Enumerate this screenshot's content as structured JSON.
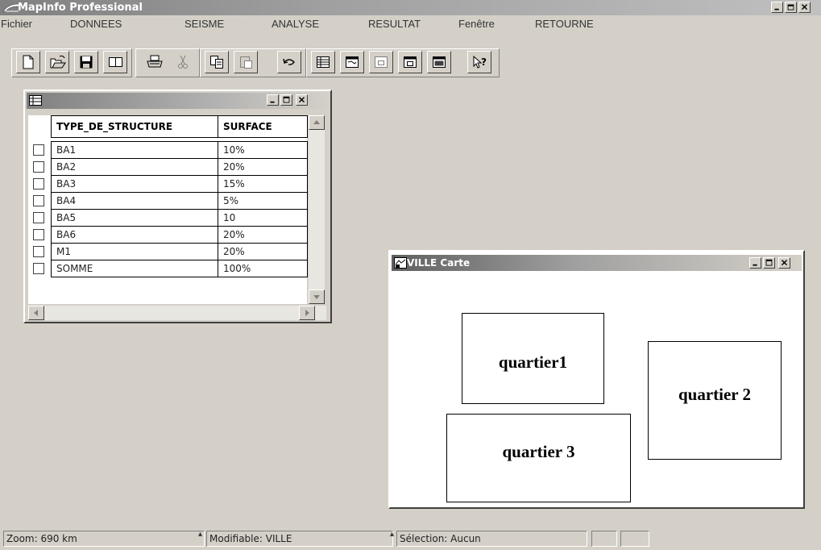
{
  "app": {
    "title": "MapInfo Professional",
    "window_buttons": [
      "minimize",
      "restore",
      "close"
    ]
  },
  "menu": {
    "items": [
      "Fichier",
      "DONNEES",
      "SEISME",
      "ANALYSE",
      "RESULTAT",
      "Fenêtre",
      "RETOURNE"
    ]
  },
  "toolbar": {
    "buttons": [
      {
        "name": "new-document-icon"
      },
      {
        "name": "open-folder-icon"
      },
      {
        "name": "save-disk-icon"
      },
      {
        "name": "open-workspace-icon"
      },
      {
        "name": "print-icon"
      },
      {
        "name": "cut-icon"
      },
      {
        "name": "copy-icon"
      },
      {
        "name": "paste-icon"
      },
      {
        "name": "undo-icon"
      },
      {
        "name": "new-browser-icon"
      },
      {
        "name": "new-map-icon"
      },
      {
        "name": "new-graph-icon"
      },
      {
        "name": "new-layout-icon"
      },
      {
        "name": "new-redistrict-icon"
      },
      {
        "name": "help-pointer-icon"
      }
    ]
  },
  "browser": {
    "title": "",
    "columns": [
      "TYPE_DE_STRUCTURE",
      "SURFACE"
    ],
    "rows": [
      {
        "type": "BA1",
        "surface": "10%"
      },
      {
        "type": "BA2",
        "surface": "20%"
      },
      {
        "type": "BA3",
        "surface": "15%"
      },
      {
        "type": "BA4",
        "surface": "5%"
      },
      {
        "type": "BA5",
        "surface": "10"
      },
      {
        "type": "BA6",
        "surface": "20%"
      },
      {
        "type": "M1",
        "surface": "20%"
      },
      {
        "type": "SOMME",
        "surface": "100%"
      }
    ]
  },
  "map": {
    "title": "VILLE Carte",
    "regions": [
      "quartier1",
      "quartier 2",
      "quartier 3"
    ]
  },
  "status": {
    "zoom": "Zoom: 690 km",
    "editable": "Modifiable: VILLE",
    "selection": "Sélection: Aucun"
  },
  "colors": {
    "chrome": "#d4d0c8",
    "titlebar_inactive": "#808080",
    "window_bg": "#ffffff"
  }
}
